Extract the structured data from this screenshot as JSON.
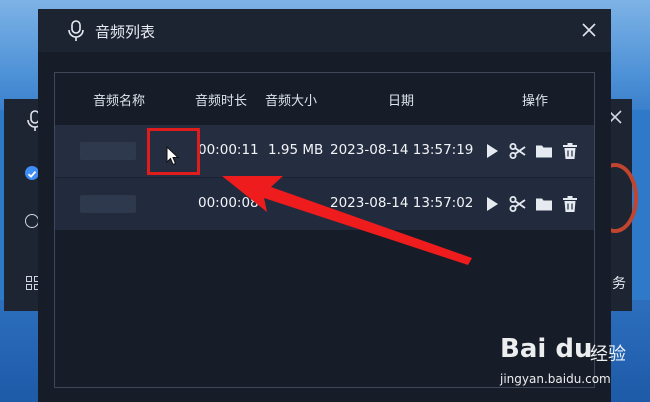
{
  "background_window": {
    "task_label": "务"
  },
  "dialog": {
    "title": "音频列表"
  },
  "table": {
    "columns": [
      "音频名称",
      "音频时长",
      "音频大小",
      "日期",
      "操作"
    ],
    "rows": [
      {
        "name": "",
        "duration": "00:00:11",
        "size": "1.95 MB",
        "date": "2023-08-14 13:57:19"
      },
      {
        "name": "",
        "duration": "00:00:08",
        "size": "",
        "date": "2023-08-14 13:57:02"
      }
    ],
    "actions": [
      "play-icon",
      "scissors-icon",
      "folder-icon",
      "trash-icon"
    ]
  },
  "watermark": {
    "logo": "Bai du",
    "logo_cn": "经验",
    "url": "jingyan.baidu.com"
  },
  "colors": {
    "dialog_bg": "#161c28",
    "highlight": "#e01d1d",
    "annotation_arrow": "#ee1c1c"
  }
}
